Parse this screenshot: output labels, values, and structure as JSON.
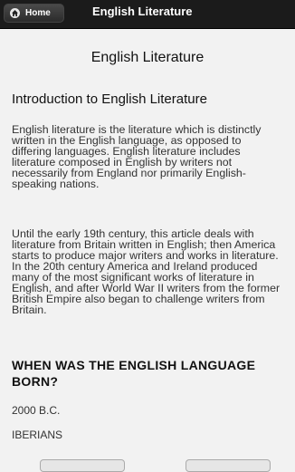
{
  "header": {
    "home_label": "Home",
    "title": "English Literature"
  },
  "page": {
    "title": "English Literature",
    "section_heading": "Introduction to English Literature",
    "paragraphs": [
      "English literature is the literature which is distinctly written in the English language, as opposed to differing languages. English literature includes literature composed in English by writers not necessarily from England nor primarily English-speaking nations.",
      "Until the early 19th century, this article deals with literature from Britain written in English; then America starts to produce major writers and works in literature. In the 20th century America and Ireland produced many of the most significant works of literature in English, and after World War II writers from the former British Empire also began to challenge writers from Britain."
    ]
  },
  "quiz": {
    "question": "WHEN WAS THE ENGLISH LANGUAGE BORN?",
    "answers": [
      "2000 B.C.",
      "IBERIANS"
    ]
  },
  "icons": {
    "home": "home-icon"
  }
}
